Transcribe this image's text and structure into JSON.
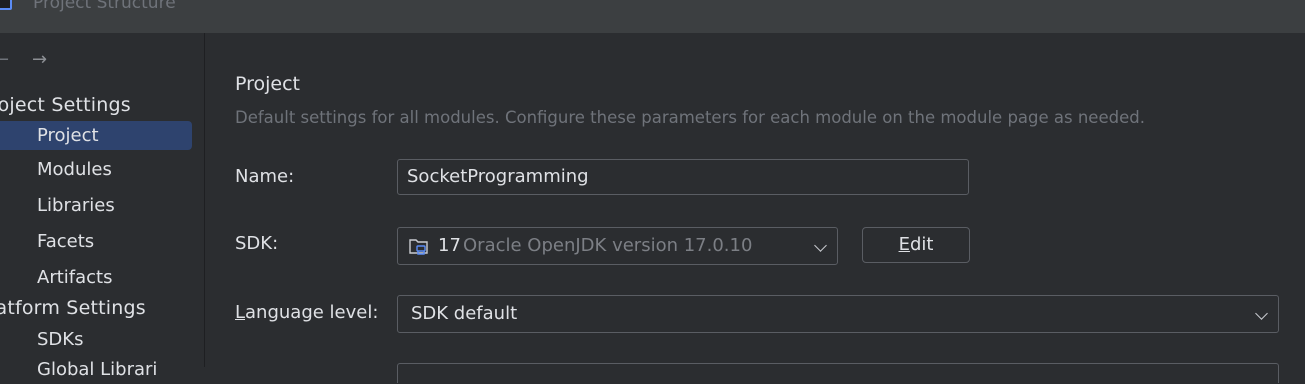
{
  "window": {
    "title": "Project Structure"
  },
  "sidebar": {
    "project_settings_header": "roject Settings",
    "platform_settings_header": "latform Settings",
    "items": [
      {
        "label": "Project"
      },
      {
        "label": "Modules"
      },
      {
        "label": "Libraries"
      },
      {
        "label": "Facets"
      },
      {
        "label": "Artifacts"
      }
    ],
    "platform_items": [
      {
        "label": "SDKs"
      },
      {
        "label": "Global Librari"
      }
    ],
    "selected": "Project"
  },
  "main": {
    "title": "Project",
    "description": "Default settings for all modules. Configure these parameters for each module on the module page as needed.",
    "name_label": "Name:",
    "name_value": "SocketProgramming",
    "sdk_label": "SDK:",
    "sdk_version": "17",
    "sdk_name": "Oracle OpenJDK version 17.0.10",
    "edit_button": {
      "mnemonic": "E",
      "rest": "dit"
    },
    "language_level_label": {
      "mnemonic": "L",
      "rest": "anguage level:"
    },
    "language_level_value": "SDK default"
  },
  "colors": {
    "background": "#2b2d30",
    "selection": "#2e436e",
    "muted_text": "#6f737a"
  }
}
